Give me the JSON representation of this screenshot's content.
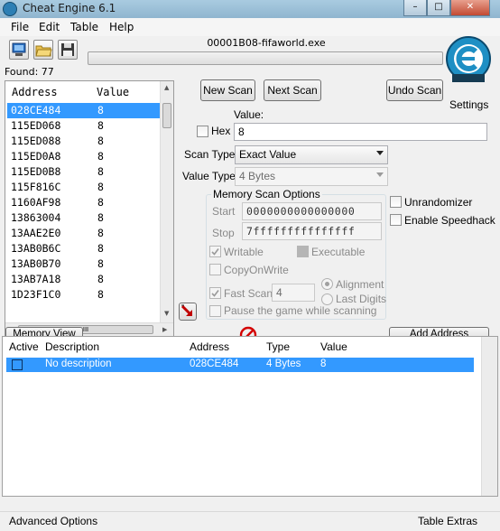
{
  "window": {
    "title": "Cheat Engine 6.1"
  },
  "menu": {
    "file": "File",
    "edit": "Edit",
    "table": "Table",
    "help": "Help"
  },
  "process": {
    "name": "00001B08-fifaworld.exe"
  },
  "found": {
    "label": "Found: 77"
  },
  "results": {
    "header_address": "Address",
    "header_value": "Value",
    "rows": [
      {
        "address": "028CE484",
        "value": "8"
      },
      {
        "address": "115ED068",
        "value": "8"
      },
      {
        "address": "115ED088",
        "value": "8"
      },
      {
        "address": "115ED0A8",
        "value": "8"
      },
      {
        "address": "115ED0B8",
        "value": "8"
      },
      {
        "address": "115F816C",
        "value": "8"
      },
      {
        "address": "1160AF98",
        "value": "8"
      },
      {
        "address": "13863004",
        "value": "8"
      },
      {
        "address": "13AAE2E0",
        "value": "8"
      },
      {
        "address": "13AB0B6C",
        "value": "8"
      },
      {
        "address": "13AB0B70",
        "value": "8"
      },
      {
        "address": "13AB7A18",
        "value": "8"
      },
      {
        "address": "1D23F1C0",
        "value": "8"
      }
    ],
    "hscroll_grip": "III"
  },
  "scan": {
    "new_scan": "New Scan",
    "next_scan": "Next Scan",
    "undo_scan": "Undo Scan",
    "settings": "Settings",
    "value_label": "Value:",
    "hex_label": "Hex",
    "value": "8",
    "scan_type_label": "Scan Type",
    "scan_type": "Exact Value",
    "value_type_label": "Value Type",
    "value_type": "4 Bytes"
  },
  "memory_options": {
    "title": "Memory Scan Options",
    "start_label": "Start",
    "start": "0000000000000000",
    "stop_label": "Stop",
    "stop": "7fffffffffffffff",
    "writable": "Writable",
    "executable": "Executable",
    "copy_on_write": "CopyOnWrite",
    "fast_scan": "Fast Scan",
    "fast_scan_value": "4",
    "alignment": "Alignment",
    "last_digits": "Last Digits",
    "pause": "Pause the game while scanning"
  },
  "options": {
    "unrandomizer": "Unrandomizer",
    "speedhack": "Enable Speedhack"
  },
  "buttons": {
    "memory_view": "Memory View",
    "add_address": "Add Address Manually"
  },
  "table": {
    "col_active": "Active",
    "col_description": "Description",
    "col_address": "Address",
    "col_type": "Type",
    "col_value": "Value",
    "rows": [
      {
        "description": "No description",
        "address": "028CE484",
        "type": "4 Bytes",
        "value": "8"
      }
    ]
  },
  "status": {
    "advanced": "Advanced Options",
    "extras": "Table Extras"
  },
  "colors": {
    "selection": "#3399ff",
    "logo": "#1e8fc4",
    "stop_red": "#d40000"
  }
}
